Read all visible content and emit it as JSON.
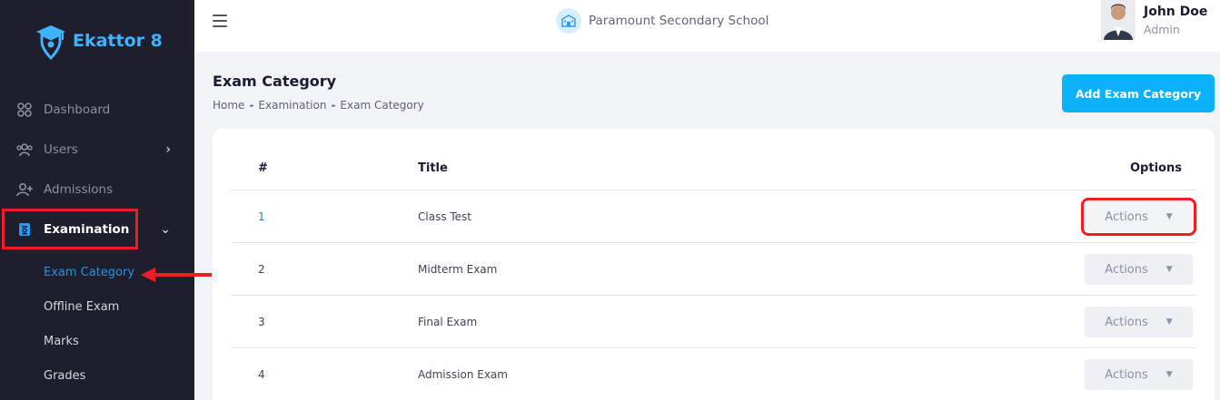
{
  "brand": {
    "name": "Ekattor 8"
  },
  "sidebar": {
    "items": [
      {
        "label": "Dashboard"
      },
      {
        "label": "Users"
      },
      {
        "label": "Admissions"
      },
      {
        "label": "Examination"
      }
    ],
    "sub_items": [
      {
        "label": "Exam Category"
      },
      {
        "label": "Offline Exam"
      },
      {
        "label": "Marks"
      },
      {
        "label": "Grades"
      }
    ]
  },
  "header": {
    "school_name": "Paramount Secondary School",
    "user_name": "John Doe",
    "user_role": "Admin"
  },
  "page": {
    "title": "Exam Category",
    "breadcrumb": [
      "Home",
      "Examination",
      "Exam Category"
    ],
    "breadcrumb_sep": "-",
    "add_button": "Add Exam Category"
  },
  "table": {
    "headers": {
      "num": "#",
      "title": "Title",
      "options": "Options"
    },
    "rows": [
      {
        "num": "1",
        "title": "Class Test",
        "action": "Actions"
      },
      {
        "num": "2",
        "title": "Midterm Exam",
        "action": "Actions"
      },
      {
        "num": "3",
        "title": "Final Exam",
        "action": "Actions"
      },
      {
        "num": "4",
        "title": "Admission Exam",
        "action": "Actions"
      }
    ]
  },
  "colors": {
    "sidebar_bg": "#1e1e2d",
    "accent": "#0bb1fb",
    "active_link": "#1d95e6",
    "highlight": "#ee1c25"
  }
}
